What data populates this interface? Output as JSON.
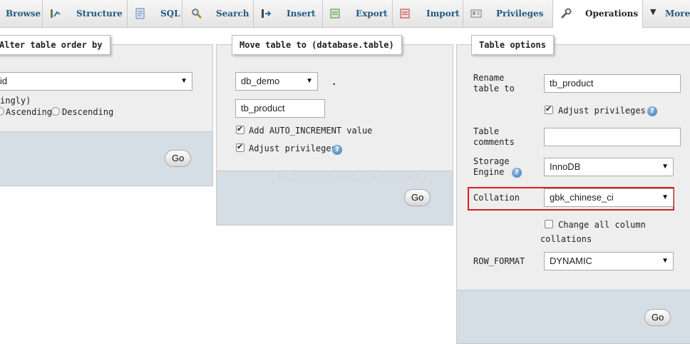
{
  "tabs": [
    {
      "label": "Browse",
      "icon": "table-icon"
    },
    {
      "label": "Structure",
      "icon": "structure-icon"
    },
    {
      "label": "SQL",
      "icon": "sql-icon"
    },
    {
      "label": "Search",
      "icon": "search-icon"
    },
    {
      "label": "Insert",
      "icon": "insert-icon"
    },
    {
      "label": "Export",
      "icon": "export-icon"
    },
    {
      "label": "Import",
      "icon": "import-icon"
    },
    {
      "label": "Privileges",
      "icon": "privileges-icon"
    },
    {
      "label": "Operations",
      "icon": "wrench-icon",
      "active": true
    },
    {
      "label": "More",
      "icon": "caret-down-icon"
    }
  ],
  "alter_order": {
    "legend": "Alter table order by",
    "column_select": "id",
    "hint": "ingly)",
    "ascending": "Ascending",
    "descending": "Descending",
    "go": "Go"
  },
  "move_table": {
    "legend": "Move table to (database.table)",
    "database_select": "db_demo",
    "dot": ".",
    "table_input": "tb_product",
    "auto_increment_label": "Add AUTO_INCREMENT value",
    "adjust_privileges_label": "Adjust privileges",
    "go": "Go"
  },
  "table_options": {
    "legend": "Table options",
    "rename_label": "Rename table to",
    "rename_value": "tb_product",
    "adjust_privileges_label": "Adjust privileges",
    "comments_label": "Table comments",
    "comments_value": "",
    "storage_engine_label": "Storage Engine",
    "storage_engine_value": "InnoDB",
    "collation_label": "Collation",
    "collation_value": "gbk_chinese_ci",
    "change_all_label_1": "Change all column",
    "change_all_label_2": "collations",
    "row_format_label": "ROW_FORMAT",
    "row_format_value": "DYNAMIC",
    "go": "Go"
  },
  "watermark": "http://blog.csdn.net/",
  "colors": {
    "tab_text": "#235a81",
    "highlight": "#d42020",
    "panel_footer": "#d5dde5"
  }
}
